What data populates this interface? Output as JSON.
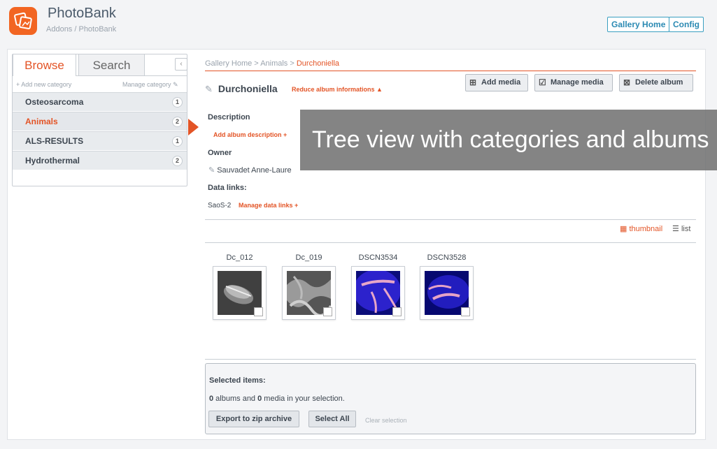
{
  "app": {
    "title": "PhotoBank",
    "breadcrumb": "Addons / PhotoBank",
    "logo_icon": "photos-icon",
    "accent_color": "#f26522"
  },
  "header_buttons": {
    "gallery_home": "Gallery Home",
    "config": "Config"
  },
  "sidebar": {
    "tabs": [
      {
        "label": "Browse",
        "active": true
      },
      {
        "label": "Search",
        "active": false
      }
    ],
    "add_category": "+ Add new category",
    "manage_category": "Manage category",
    "categories": [
      {
        "label": "Osteosarcoma",
        "count": "1",
        "active": false
      },
      {
        "label": "Animals",
        "count": "2",
        "active": true
      },
      {
        "label": "ALS-RESULTS",
        "count": "1",
        "active": false
      },
      {
        "label": "Hydrothermal",
        "count": "2",
        "active": false
      }
    ]
  },
  "breadcrumb": {
    "part1": "Gallery Home",
    "sep": " > ",
    "part2": "Animals",
    "current": "Durchoniella"
  },
  "album": {
    "title": "Durchoniella",
    "reduce_link": "Reduce album informations ▲",
    "description_label": "Description",
    "add_description": "Add album description +",
    "owner_label": "Owner",
    "owner_name": "Sauvadet Anne-Laure",
    "data_links_label": "Data links:",
    "data_link": "SaoS-2",
    "manage_data_links": "Manage data links +"
  },
  "actions": {
    "add_media": "Add media",
    "manage_media": "Manage media",
    "delete_album": "Delete album"
  },
  "overlay_caption": "Tree view with categories and albums",
  "view": {
    "thumbnail": "thumbnail",
    "list": "list"
  },
  "media": [
    {
      "name": "Dc_012"
    },
    {
      "name": "Dc_019"
    },
    {
      "name": "DSCN3534"
    },
    {
      "name": "DSCN3528"
    }
  ],
  "selection": {
    "title": "Selected items:",
    "albums_count": "0",
    "albums_text": " albums and ",
    "media_count": "0",
    "media_text": " media in your selection.",
    "export_label": "Export to zip archive",
    "select_all_label": "Select All",
    "clear_label": "Clear selection"
  }
}
